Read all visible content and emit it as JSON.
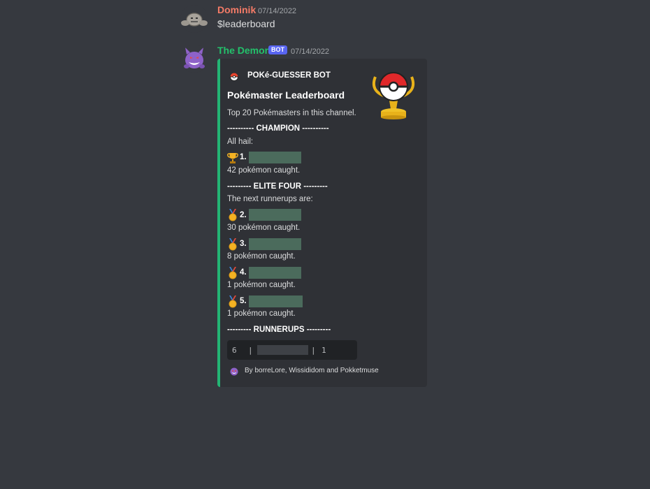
{
  "messages": [
    {
      "username": "Dominik",
      "username_color": "#f47b67",
      "timestamp": "07/14/2022",
      "content": "$leaderboard"
    },
    {
      "username": "The Demon",
      "username_color": "#23c16b",
      "bot_tag": "BOT",
      "timestamp": "07/14/2022"
    }
  ],
  "embed": {
    "accent_color": "#23b574",
    "author": "POKé-GUESSER BOT",
    "author_icon": "pokeball-icon",
    "thumbnail_icon": "trophy-pokeball-icon",
    "title": "Pokémaster Leaderboard",
    "description": "Top 20 Pokémasters in this channel.",
    "champion_header": "---------- CHAMPION ----------",
    "champion_intro": "All hail:",
    "champion": {
      "rank": "1.",
      "icon": "trophy-icon",
      "caught": "42 pokémon caught."
    },
    "elite_header": "--------- ELITE FOUR ---------",
    "elite_intro": "The next runnerups are:",
    "elite": [
      {
        "rank": "2.",
        "icon": "medal-icon",
        "caught": "30 pokémon caught."
      },
      {
        "rank": "3.",
        "icon": "medal-icon",
        "caught": "8 pokémon caught."
      },
      {
        "rank": "4.",
        "icon": "medal-icon",
        "caught": "1 pokémon caught."
      },
      {
        "rank": "5.",
        "icon": "medal-icon",
        "caught": "1 pokémon caught."
      }
    ],
    "runnerups_header": "--------- RUNNERUPS ---------",
    "runnerups_table": {
      "rank": "6",
      "sep1": "|",
      "sep2": "|",
      "count": "1"
    },
    "footer": "By borreLore, Wissididom and Pokketmuse",
    "footer_icon": "gengar-icon"
  }
}
